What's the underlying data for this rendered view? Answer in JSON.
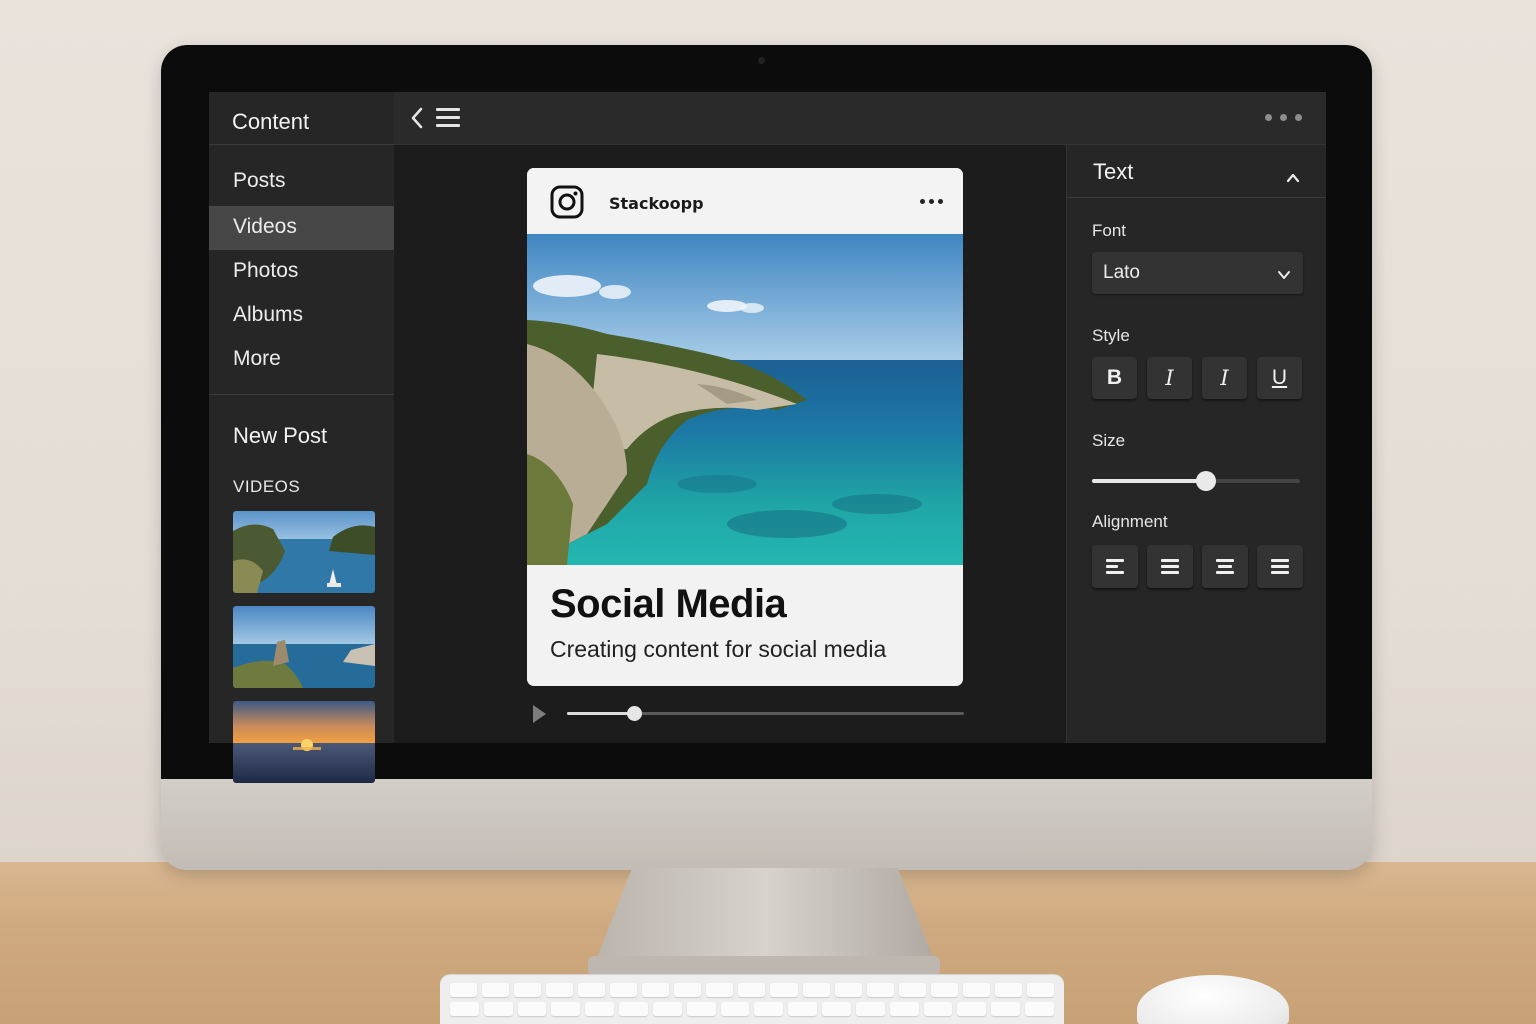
{
  "sidebar": {
    "title": "Content",
    "items": [
      {
        "label": "Posts",
        "active": false
      },
      {
        "label": "Videos",
        "active": true
      },
      {
        "label": "Photos",
        "active": false
      },
      {
        "label": "Albums",
        "active": false
      },
      {
        "label": "More",
        "active": false
      }
    ],
    "new_post_label": "New Post",
    "section_label": "VIDEOS",
    "thumbnails": [
      "coastal-cove-boat-thumbnail",
      "rocky-coast-thumbnail",
      "sunset-sea-thumbnail"
    ]
  },
  "topbar": {
    "icons": [
      "back-chevron-icon",
      "hamburger-menu-icon",
      "more-dots-icon"
    ]
  },
  "post": {
    "username": "Stackoopp",
    "title": "Social Media",
    "subtitle": "Creating content for social media",
    "image": "sea-cliff-coastline-photo",
    "platform_icon": "instagram-icon"
  },
  "player": {
    "progress_percent": 17
  },
  "text_panel": {
    "title": "Text",
    "font_label": "Font",
    "font_value": "Lato",
    "style_label": "Style",
    "style_buttons": [
      "B",
      "I",
      "I",
      "U"
    ],
    "size_label": "Size",
    "size_percent": 55,
    "alignment_label": "Alignment",
    "alignment_options": [
      "align-left-icon",
      "align-center-icon",
      "align-right-icon",
      "align-justify-icon"
    ]
  },
  "colors": {
    "screen_bg": "#1b1b1b",
    "panel_bg": "#262626",
    "active_item": "#474747",
    "card_bg": "#f2f2f2"
  }
}
